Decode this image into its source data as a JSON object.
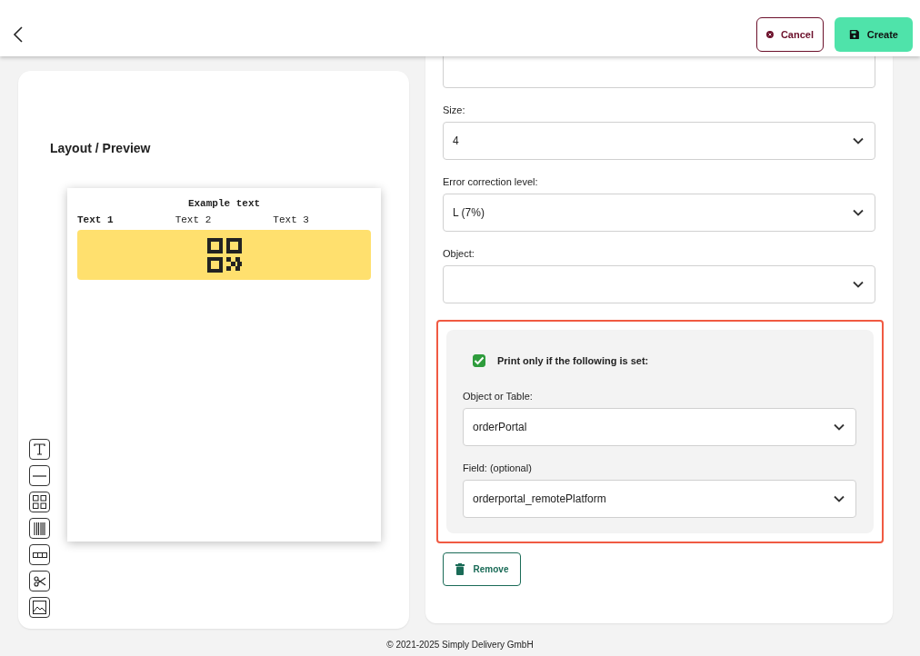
{
  "header": {
    "buttons": [
      {
        "kind": "cancel",
        "label": "Cancel"
      },
      {
        "kind": "create",
        "label": "Create"
      }
    ]
  },
  "preview": {
    "title": "Layout / Preview",
    "paper": {
      "heading": "Example text",
      "columns": [
        {
          "text": "Text 1",
          "bold": true
        },
        {
          "text": "Text 2",
          "bold": false
        },
        {
          "text": "Text 3",
          "bold": false
        }
      ]
    }
  },
  "form": {
    "fields": [
      {
        "kind": "input"
      },
      {
        "kind": "select",
        "label": "Size:",
        "value": "4"
      },
      {
        "kind": "select",
        "label": "Error correction level:",
        "value": "L (7%)"
      },
      {
        "kind": "select",
        "label": "Object:"
      }
    ],
    "condition": {
      "highlighted": true,
      "checked": true,
      "label": "Print only if the following is set:",
      "fields": [
        {
          "kind": "select",
          "label": "Object or Table:",
          "value": "orderPortal"
        },
        {
          "kind": "select",
          "label": "Field: (optional)",
          "value": "orderportal_remotePlatform"
        }
      ]
    },
    "remove_button": "Remove"
  },
  "footer": "© 2021-2025 Simply Delivery GmbH"
}
